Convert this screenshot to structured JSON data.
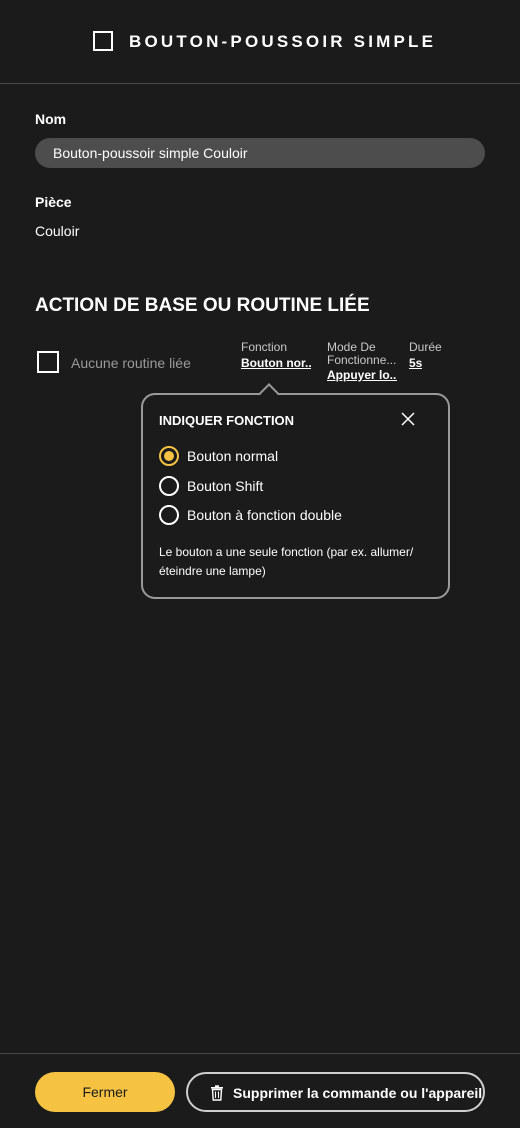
{
  "header": {
    "title": "BOUTON-POUSSOIR SIMPLE"
  },
  "form": {
    "name_label": "Nom",
    "name_value": "Bouton-poussoir simple Couloir",
    "room_label": "Pièce",
    "room_value": "Couloir"
  },
  "action": {
    "section_title": "ACTION DE BASE OU ROUTINE LIÉE",
    "routine_label": "Aucune routine liée",
    "routine_checked": false,
    "columns": [
      {
        "header": "Fonction",
        "value": "Bouton nor..."
      },
      {
        "header": "Mode De Fonctionne...",
        "value": "Appuyer lo..."
      },
      {
        "header": "Durée",
        "value": "5s"
      }
    ]
  },
  "popover": {
    "title": "INDIQUER FONCTION",
    "options": [
      {
        "label": "Bouton normal",
        "selected": true
      },
      {
        "label": "Bouton Shift",
        "selected": false
      },
      {
        "label": "Bouton à fonction double",
        "selected": false
      }
    ],
    "description": "Le bouton a une seule fonction (par ex. allumer/ éteindre une lampe)"
  },
  "footer": {
    "close_label": "Fermer",
    "delete_label": "Supprimer la commande ou l'appareil"
  },
  "colors": {
    "background": "#1b1b1b",
    "accent": "#f5c242",
    "input_bg": "#4d4d4d",
    "muted_text": "#9a9a9a"
  },
  "icons": {
    "header": "device-square-icon",
    "close": "close-icon",
    "delete": "trash-icon"
  }
}
